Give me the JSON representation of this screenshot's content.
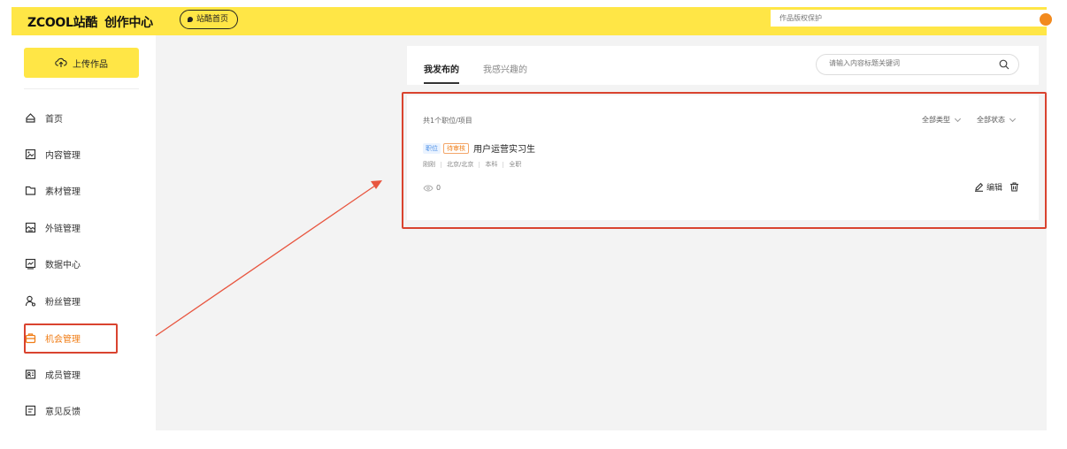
{
  "header": {
    "logo_brand": "ZCOOL站酷",
    "logo_sub": "创作中心",
    "home_label": "站酷首页",
    "protect_placeholder": "作品版权保护"
  },
  "sidebar": {
    "upload_label": "上传作品",
    "items": [
      {
        "label": "首页",
        "icon": "home-icon"
      },
      {
        "label": "内容管理",
        "icon": "image-icon"
      },
      {
        "label": "素材管理",
        "icon": "folder-icon"
      },
      {
        "label": "外链管理",
        "icon": "picture-link-icon"
      },
      {
        "label": "数据中心",
        "icon": "chart-icon"
      },
      {
        "label": "粉丝管理",
        "icon": "user-icon"
      },
      {
        "label": "机会管理",
        "icon": "briefcase-icon",
        "active": true
      },
      {
        "label": "成员管理",
        "icon": "id-card-icon"
      },
      {
        "label": "意见反馈",
        "icon": "feedback-icon"
      }
    ]
  },
  "main": {
    "tabs": [
      {
        "label": "我发布的",
        "active": true
      },
      {
        "label": "我感兴趣的",
        "active": false
      }
    ],
    "search_placeholder": "请输入内容标题关键词",
    "count_text": "共1个职位/项目",
    "filters": {
      "type": "全部类型",
      "status": "全部状态"
    },
    "job": {
      "tag_type": "职位",
      "tag_status": "待审核",
      "title": "用户运营实习生",
      "meta_time": "刚刚",
      "meta_location": "北京/北京",
      "meta_education": "本科",
      "meta_jobtype": "全职",
      "views": "0",
      "edit_label": "编辑"
    }
  },
  "colors": {
    "brand_yellow": "#ffe646",
    "active_orange": "#f07d16",
    "annotation_red": "#d9432f"
  }
}
